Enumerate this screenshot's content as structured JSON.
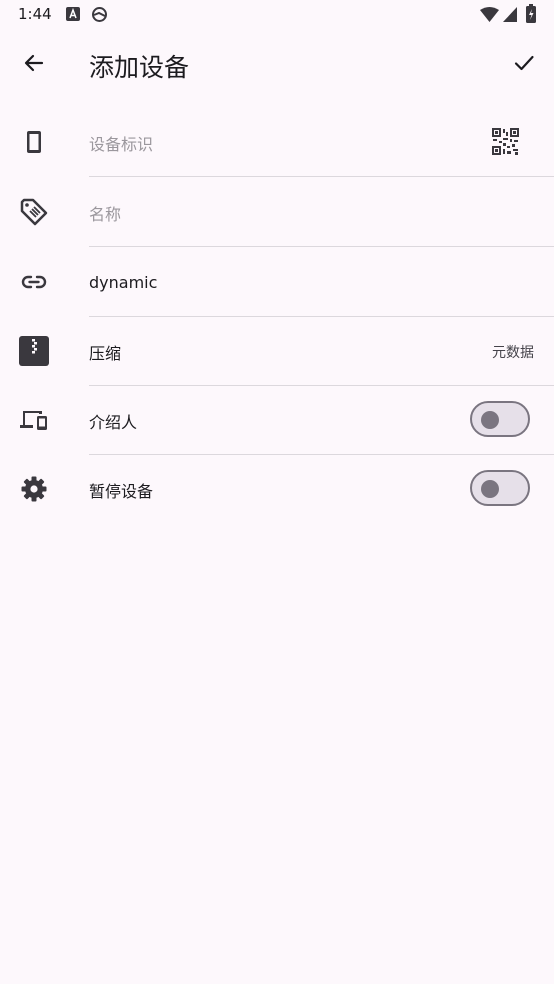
{
  "status": {
    "time": "1:44"
  },
  "appbar": {
    "title": "添加设备"
  },
  "form": {
    "device_id_placeholder": "设备标识",
    "name_placeholder": "名称",
    "address_value": "dynamic",
    "compression_label": "压缩",
    "compression_value": "元数据",
    "introducer_label": "介绍人",
    "introducer_on": false,
    "paused_label": "暂停设备",
    "paused_on": false
  },
  "colors": {
    "background": "#fdf8fc",
    "icon": "#3a383e",
    "divider": "#dcd8dd",
    "switch_track": "#e6e0e9",
    "switch_outline": "#7a7580"
  }
}
